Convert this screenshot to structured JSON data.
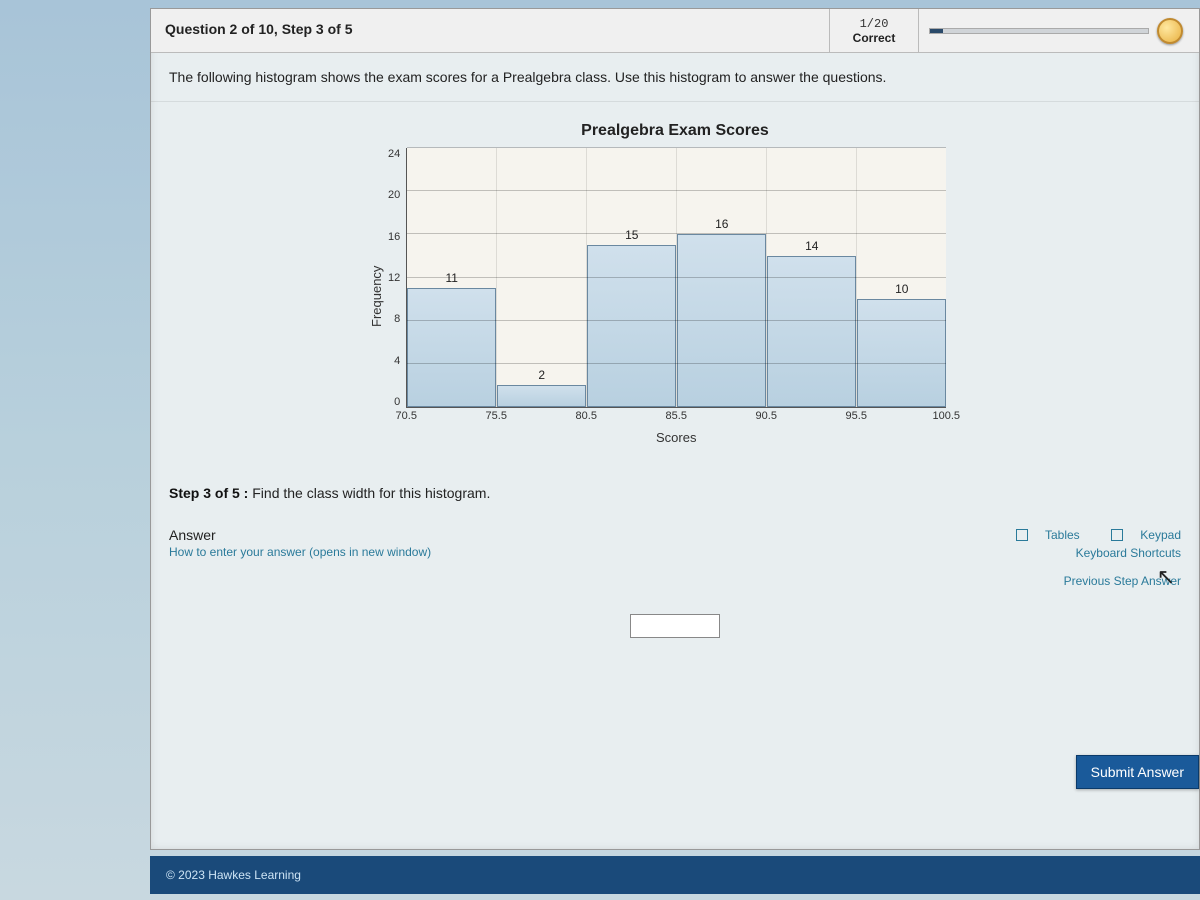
{
  "header": {
    "question_label": "Question 2 of 10, Step 3 of 5",
    "score_top": "1/20",
    "score_bottom": "Correct"
  },
  "instructions": "The following histogram shows the exam scores for a Prealgebra class. Use this histogram to answer the questions.",
  "chart_data": {
    "type": "bar",
    "title": "Prealgebra Exam Scores",
    "xlabel": "Scores",
    "ylabel": "Frequency",
    "ylim": [
      0,
      24
    ],
    "yticks": [
      0,
      4,
      8,
      12,
      16,
      20,
      24
    ],
    "bin_edges": [
      70.5,
      75.5,
      80.5,
      85.5,
      90.5,
      95.5,
      100.5
    ],
    "categories": [
      "70.5–75.5",
      "75.5–80.5",
      "80.5–85.5",
      "85.5–90.5",
      "90.5–95.5",
      "95.5–100.5"
    ],
    "values": [
      11,
      2,
      15,
      16,
      14,
      10
    ]
  },
  "step": {
    "label_bold": "Step 3 of 5 :",
    "label_rest": " Find the class width for this histogram."
  },
  "answer_area": {
    "title": "Answer",
    "how_link": "How to enter your answer (opens in new window)",
    "tables_link": "Tables",
    "keypad_link": "Keypad",
    "kbd_shortcuts": "Keyboard Shortcuts",
    "previous": "Previous Step Answer",
    "input_value": ""
  },
  "submit_label": "Submit Answer",
  "footer": "© 2023 Hawkes Learning"
}
